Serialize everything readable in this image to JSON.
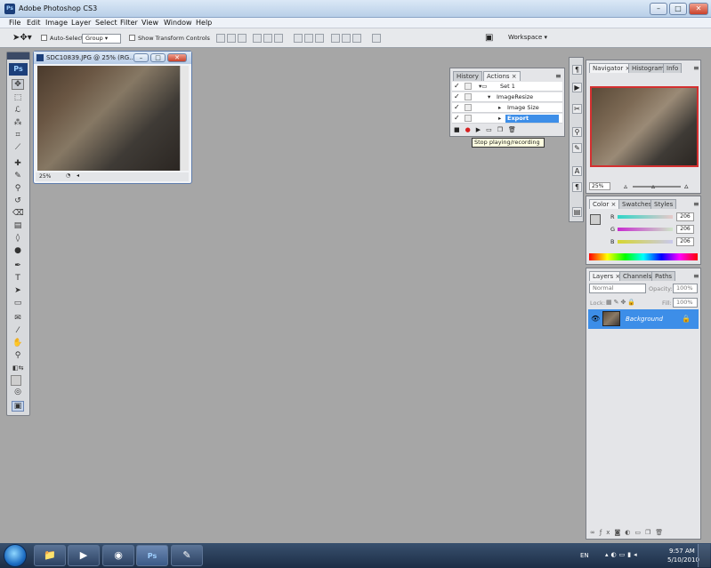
{
  "window": {
    "title": "Adobe Photoshop CS3",
    "app_icon": "Ps",
    "min_label": "–",
    "max_label": "□",
    "close_label": "✕"
  },
  "menu": [
    "File",
    "Edit",
    "Image",
    "Layer",
    "Select",
    "Filter",
    "View",
    "Window",
    "Help"
  ],
  "options": {
    "auto_select_label": "Auto-Select:",
    "auto_select_value": "Group",
    "show_transform_label": "Show Transform Controls",
    "workspace_label": "Workspace ▾"
  },
  "toolbox": {
    "logo": "Ps"
  },
  "document": {
    "title": "SDC10839.JPG @ 25% (RG...",
    "zoom": "25%",
    "min_label": "–",
    "max_label": "□",
    "close_label": "✕"
  },
  "actions_panel": {
    "tabs": [
      "History",
      "Actions ×"
    ],
    "rows": [
      {
        "label": "Set 1",
        "check": "✓"
      },
      {
        "label": "ImageResize",
        "check": "✓"
      },
      {
        "label": "Image Size",
        "check": "✓"
      },
      {
        "label": "Export",
        "check": "✓"
      }
    ],
    "tooltip": "Stop playing/recording"
  },
  "navigator_panel": {
    "tabs": [
      "Navigator ×",
      "Histogram",
      "Info"
    ],
    "zoom": "25%"
  },
  "color_panel": {
    "tabs": [
      "Color ×",
      "Swatches",
      "Styles"
    ],
    "channels": [
      {
        "label": "R",
        "value": "206"
      },
      {
        "label": "G",
        "value": "206"
      },
      {
        "label": "B",
        "value": "206"
      }
    ]
  },
  "layers_panel": {
    "tabs": [
      "Layers ×",
      "Channels",
      "Paths"
    ],
    "blend_mode": "Normal",
    "opacity_label": "Opacity:",
    "opacity_value": "100%",
    "lock_label": "Lock:",
    "fill_label": "Fill:",
    "fill_value": "100%",
    "layers": [
      {
        "name": "Background"
      }
    ]
  },
  "taskbar": {
    "language": "EN",
    "time": "9:57 AM",
    "date": "5/10/2010",
    "ps_label": "Ps"
  },
  "colors": {
    "accent": "#3d8ee8",
    "panel_bg": "#e4e5e8",
    "canvas_bg": "#a6a6a6"
  }
}
